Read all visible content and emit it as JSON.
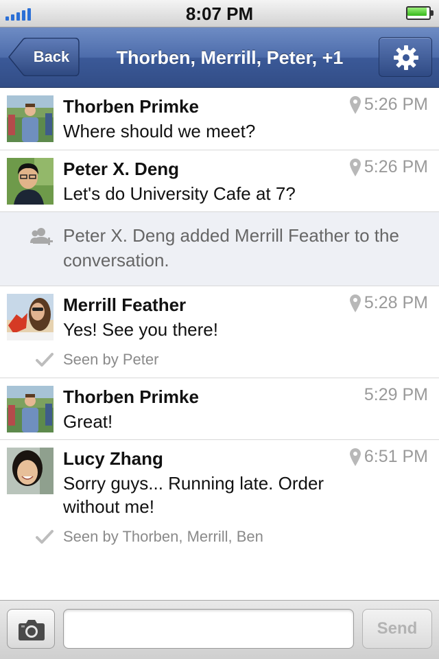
{
  "status_bar": {
    "time": "8:07 PM",
    "signal_bars": 5,
    "battery_level": 0.9,
    "signal_color": "#2b6fd6",
    "battery_color": "#35b81a"
  },
  "nav": {
    "back_label": "Back",
    "title": "Thorben, Merrill, Peter, +1",
    "settings_icon": "gear-icon",
    "bar_color": "#3b5998"
  },
  "messages": [
    {
      "sender": "Thorben Primke",
      "text": "Where should we meet?",
      "time": "5:26 PM",
      "has_location": true
    },
    {
      "sender": "Peter X. Deng",
      "text": "Let's do University Cafe at 7?",
      "time": "5:26 PM",
      "has_location": true
    },
    {
      "system": "Peter X. Deng added Merrill Feather to the conversation."
    },
    {
      "sender": "Merrill Feather",
      "text": "Yes! See you there!",
      "time": "5:28 PM",
      "has_location": true,
      "seen": "Seen by Peter"
    },
    {
      "sender": "Thorben Primke",
      "text": "Great!",
      "time": "5:29 PM",
      "has_location": false
    },
    {
      "sender": "Lucy Zhang",
      "text": "Sorry guys... Running late. Order without me!",
      "time": "6:51 PM",
      "has_location": true,
      "seen": "Seen by Thorben, Merrill, Ben"
    }
  ],
  "composer": {
    "camera_icon": "camera-icon",
    "input_value": "",
    "send_label": "Send"
  }
}
